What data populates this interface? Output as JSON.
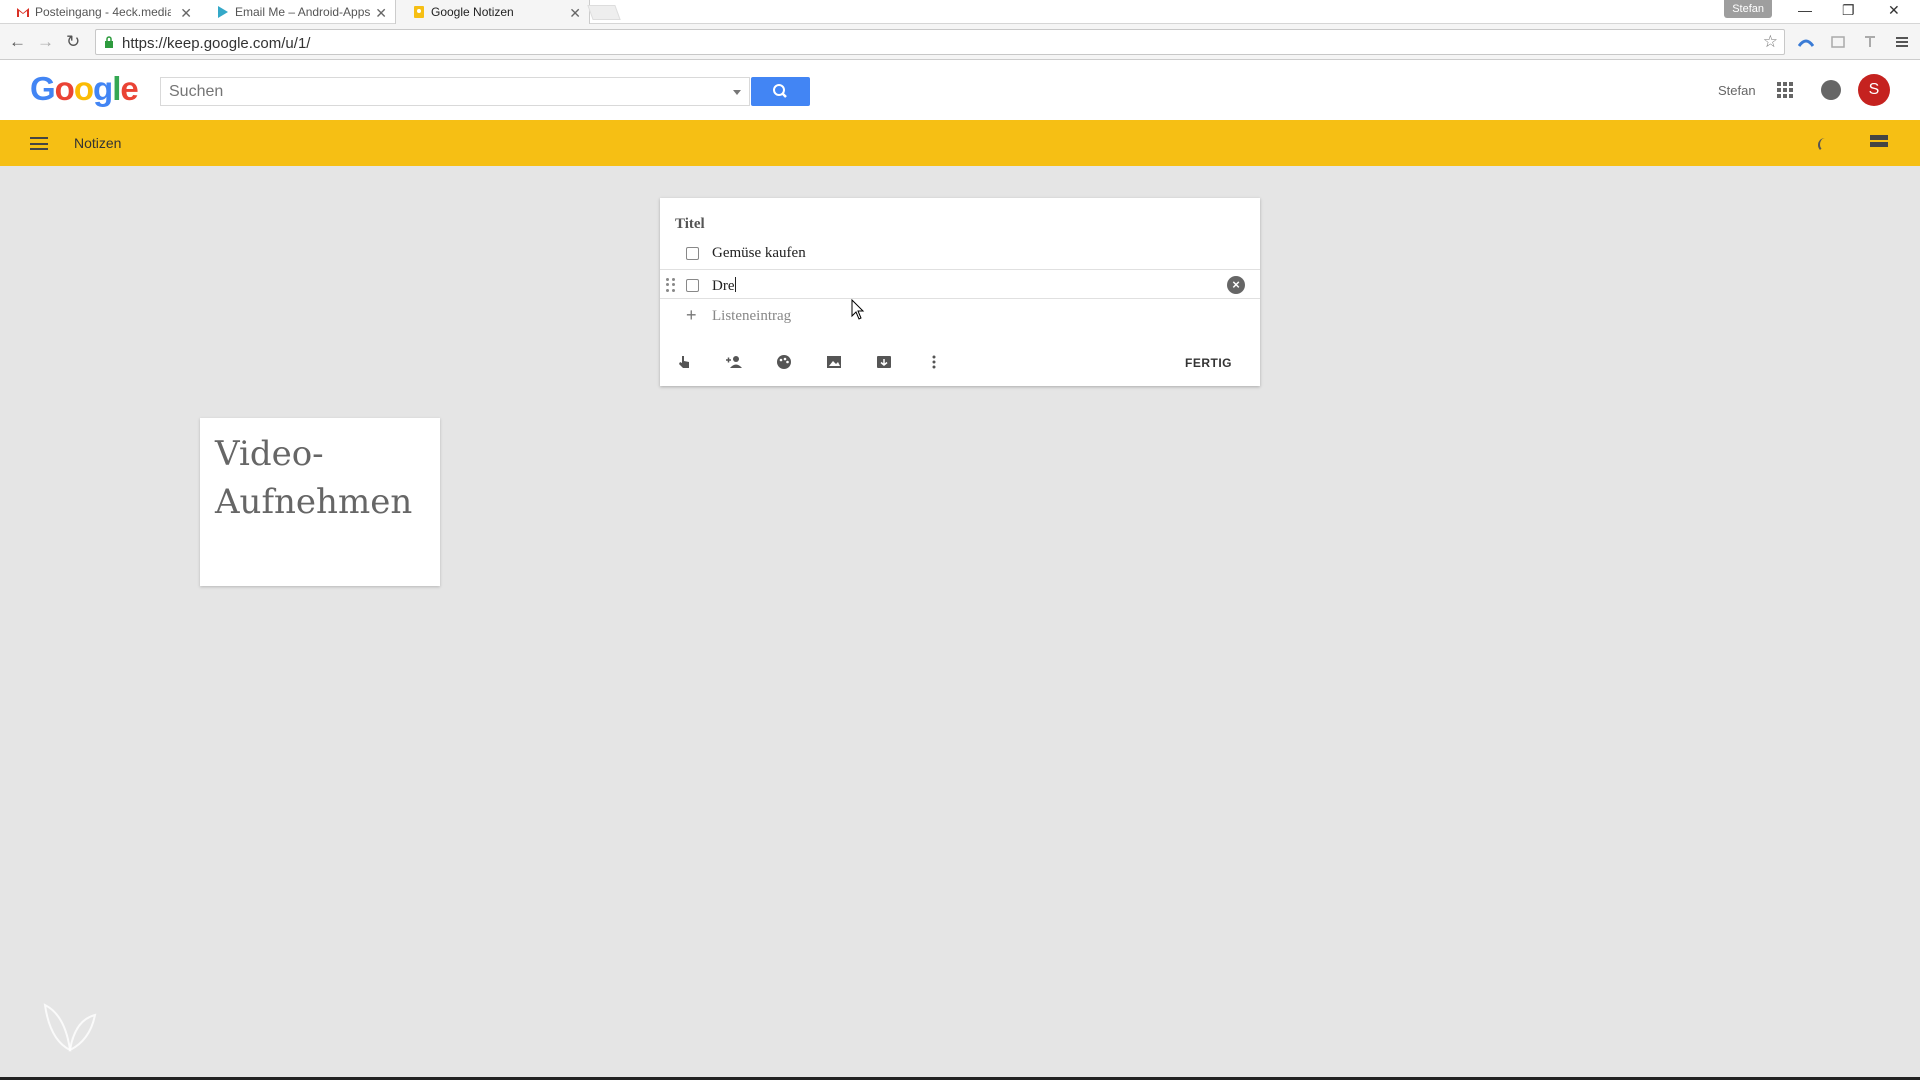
{
  "browser": {
    "tabs": [
      {
        "title": "Posteingang - 4eck.media",
        "icon": "gmail-icon"
      },
      {
        "title": "Email Me – Android-Apps",
        "icon": "play-store-icon"
      },
      {
        "title": "Google Notizen",
        "icon": "keep-icon"
      }
    ],
    "profile": "Stefan",
    "url": "https://keep.google.com/u/1/"
  },
  "header": {
    "logo": "Google",
    "search_placeholder": "Suchen",
    "user_name": "Stefan",
    "avatar_letter": "S"
  },
  "keepbar": {
    "title": "Notizen"
  },
  "editor": {
    "title_placeholder": "Titel",
    "items": [
      {
        "text": "Gemüse kaufen",
        "checked": false
      },
      {
        "text": "Dre",
        "checked": false
      }
    ],
    "add_item_placeholder": "Listeneintrag",
    "toolbar_icons": [
      "reminder-icon",
      "collaborator-icon",
      "color-palette-icon",
      "image-icon",
      "archive-icon",
      "more-icon"
    ],
    "done_label": "FERTIG"
  },
  "notes": [
    {
      "text": "Video-Aufnehmen"
    }
  ],
  "colors": {
    "keep_yellow": "#f6bf14",
    "search_blue": "#4285f4",
    "avatar_red": "#c5221f"
  }
}
